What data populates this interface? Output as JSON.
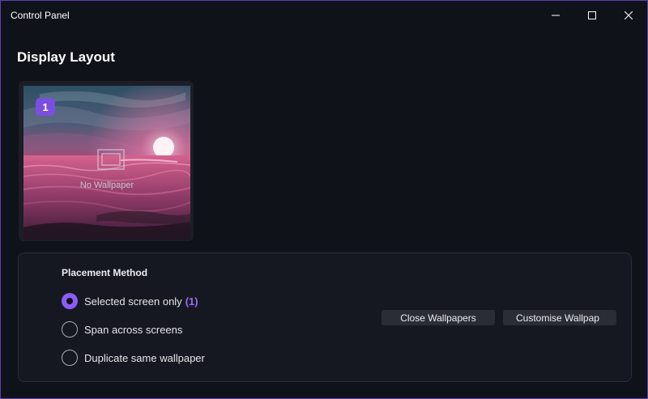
{
  "window": {
    "title": "Control Panel"
  },
  "page": {
    "heading": "Display Layout"
  },
  "monitor": {
    "badge": "1",
    "status_label": "No Wallpaper"
  },
  "placement": {
    "title": "Placement Method",
    "options": [
      {
        "label": "Selected screen only",
        "count": "(1)",
        "checked": true
      },
      {
        "label": "Span across screens",
        "checked": false
      },
      {
        "label": "Duplicate same wallpaper",
        "checked": false
      }
    ]
  },
  "actions": {
    "close_label": "Close Wallpapers",
    "customise_label": "Customise Wallpap"
  },
  "colors": {
    "accent": "#8b5cf6",
    "window_border": "#5b3fb3",
    "background": "#10121a"
  },
  "icons": {
    "minimize": "minimize-icon",
    "maximize": "maximize-icon",
    "close": "close-icon",
    "no_wallpaper": "monitor-frame-icon"
  }
}
